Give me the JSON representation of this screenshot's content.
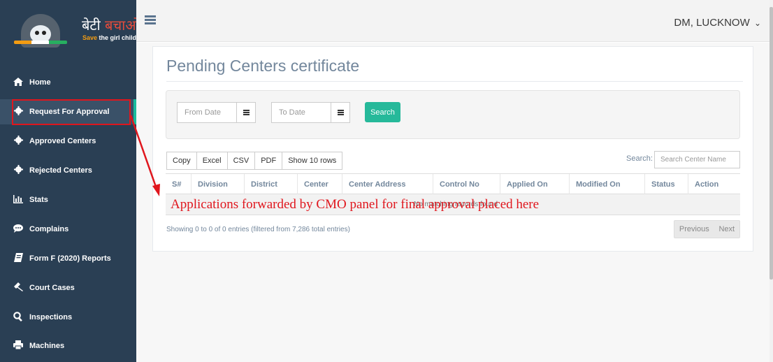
{
  "logo": {
    "hindi_part1": "बेटी ",
    "hindi_part2": "बचाओ",
    "sub_part1": "Save",
    "sub_part2": " the girl child"
  },
  "sidebar": {
    "items": [
      {
        "label": "Home",
        "icon": "home-icon"
      },
      {
        "label": "Request For Approval",
        "icon": "gear-icon"
      },
      {
        "label": "Approved Centers",
        "icon": "gear-icon"
      },
      {
        "label": "Rejected Centers",
        "icon": "gear-icon"
      },
      {
        "label": "Stats",
        "icon": "bar-chart-icon"
      },
      {
        "label": "Complains",
        "icon": "speech-bubble-icon"
      },
      {
        "label": "Form F (2020) Reports",
        "icon": "book-icon"
      },
      {
        "label": "Court Cases",
        "icon": "gavel-icon"
      },
      {
        "label": "Inspections",
        "icon": "search-icon"
      },
      {
        "label": "Machines",
        "icon": "printer-icon"
      }
    ],
    "active_index": 1
  },
  "header": {
    "user": "DM, LUCKNOW",
    "user_caret": "⌄"
  },
  "page": {
    "title": "Pending Centers certificate"
  },
  "filters": {
    "from_date_placeholder": "From Date",
    "to_date_placeholder": "To Date",
    "search_button": "Search"
  },
  "table": {
    "buttons": [
      "Copy",
      "Excel",
      "CSV",
      "PDF",
      "Show 10 rows"
    ],
    "search_label": "Search:",
    "search_placeholder": "Search Center Name",
    "columns": [
      "S#",
      "Division",
      "District",
      "Center",
      "Center Address",
      "Control No",
      "Applied On",
      "Modified On",
      "Status",
      "Action"
    ],
    "empty_message": "No matching records found",
    "info": "Showing 0 to 0 of 0 entries (filtered from 7,286 total entries)",
    "pagination": {
      "previous": "Previous",
      "next": "Next"
    }
  },
  "annotation": {
    "text": "Applications forwarded by CMO panel for final approval placed here"
  },
  "colors": {
    "sidebar_bg": "#2a3f54",
    "accent_green": "#26b99a",
    "annotation_red": "#e0161d",
    "title_gray": "#73879c"
  }
}
